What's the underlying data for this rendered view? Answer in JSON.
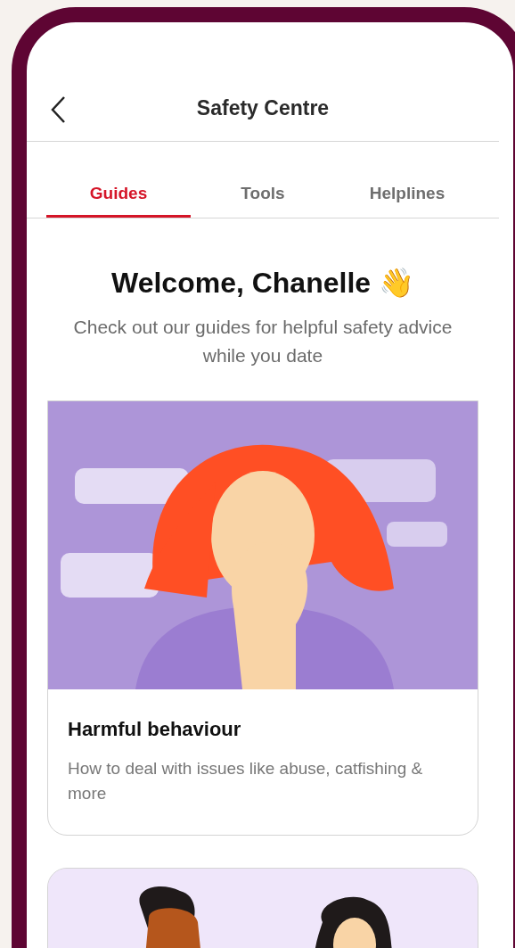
{
  "header": {
    "title": "Safety Centre"
  },
  "tabs": [
    {
      "label": "Guides",
      "selected": true
    },
    {
      "label": "Tools",
      "selected": false
    },
    {
      "label": "Helplines",
      "selected": false
    }
  ],
  "welcome": {
    "heading": "Welcome, Chanelle 👋",
    "subtitle": "Check out our guides for helpful safety advice while you date"
  },
  "guides": [
    {
      "title": "Harmful behaviour",
      "description": "How to deal with issues like abuse, catfishing & more",
      "picture": {
        "kind": "picture"
      }
    },
    {
      "picture": {
        "kind": "picture"
      }
    }
  ]
}
